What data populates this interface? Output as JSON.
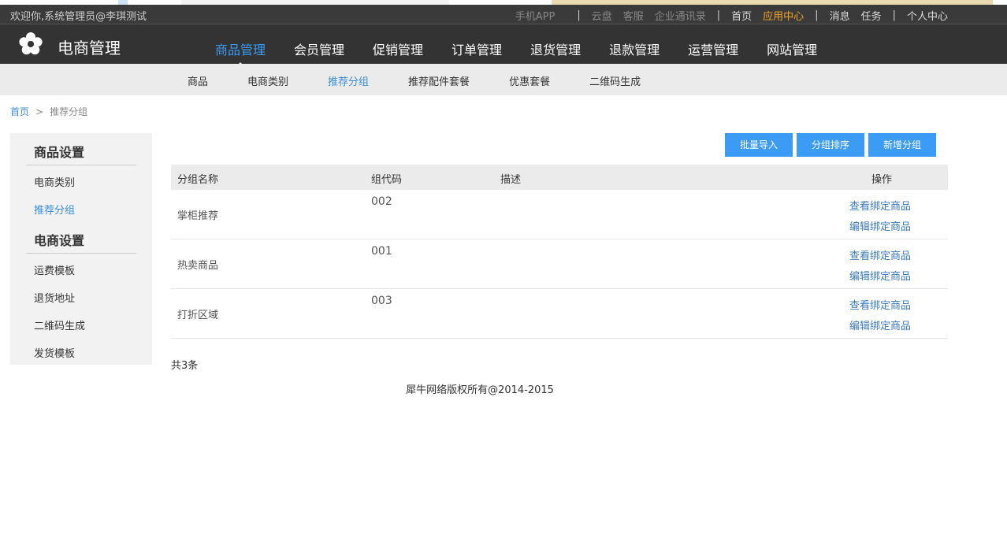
{
  "topbar": {
    "welcome": "欢迎你,系统管理员@李琪测试",
    "links": {
      "mobile_app": "手机APP",
      "cloud": "云盘",
      "service": "客服",
      "contacts": "企业通讯录",
      "home": "首页",
      "app_center": "应用中心",
      "messages": "消息",
      "tasks": "任务",
      "personal": "个人中心"
    },
    "separator": "|"
  },
  "brand": {
    "name": "电商管理",
    "icon": "flower-icon"
  },
  "mainnav": [
    "商品管理",
    "会员管理",
    "促销管理",
    "订单管理",
    "退货管理",
    "退款管理",
    "运营管理",
    "网站管理"
  ],
  "subnav": [
    "商品",
    "电商类别",
    "推荐分组",
    "推荐配件套餐",
    "优惠套餐",
    "二维码生成"
  ],
  "breadcrumb": {
    "home": "首页",
    "arrow": ">",
    "current": "推荐分组"
  },
  "sidebar": {
    "section1": {
      "title": "商品设置",
      "items": [
        "电商类别",
        "推荐分组"
      ]
    },
    "section2": {
      "title": "电商设置",
      "items": [
        "运费模板",
        "退货地址",
        "二维码生成",
        "发货模板"
      ]
    }
  },
  "buttons": {
    "import": "批量导入",
    "sort": "分组排序",
    "add": "新增分组"
  },
  "table": {
    "headers": {
      "name": "分组名称",
      "code": "组代码",
      "desc": "描述",
      "ops": "操作"
    },
    "rows": [
      {
        "name": "掌柜推荐",
        "code": "002",
        "desc": "",
        "op_view": "查看绑定商品",
        "op_edit": "编辑绑定商品"
      },
      {
        "name": "热卖商品",
        "code": "001",
        "desc": "",
        "op_view": "查看绑定商品",
        "op_edit": "编辑绑定商品"
      },
      {
        "name": "打折区域",
        "code": "003",
        "desc": "",
        "op_view": "查看绑定商品",
        "op_edit": "编辑绑定商品"
      }
    ]
  },
  "total": "共3条",
  "footer": "犀牛网络版权所有@2014-2015",
  "colors": {
    "accent": "#3b9bf5",
    "highlight": "#f5a623",
    "dark_bar": "#333333"
  }
}
